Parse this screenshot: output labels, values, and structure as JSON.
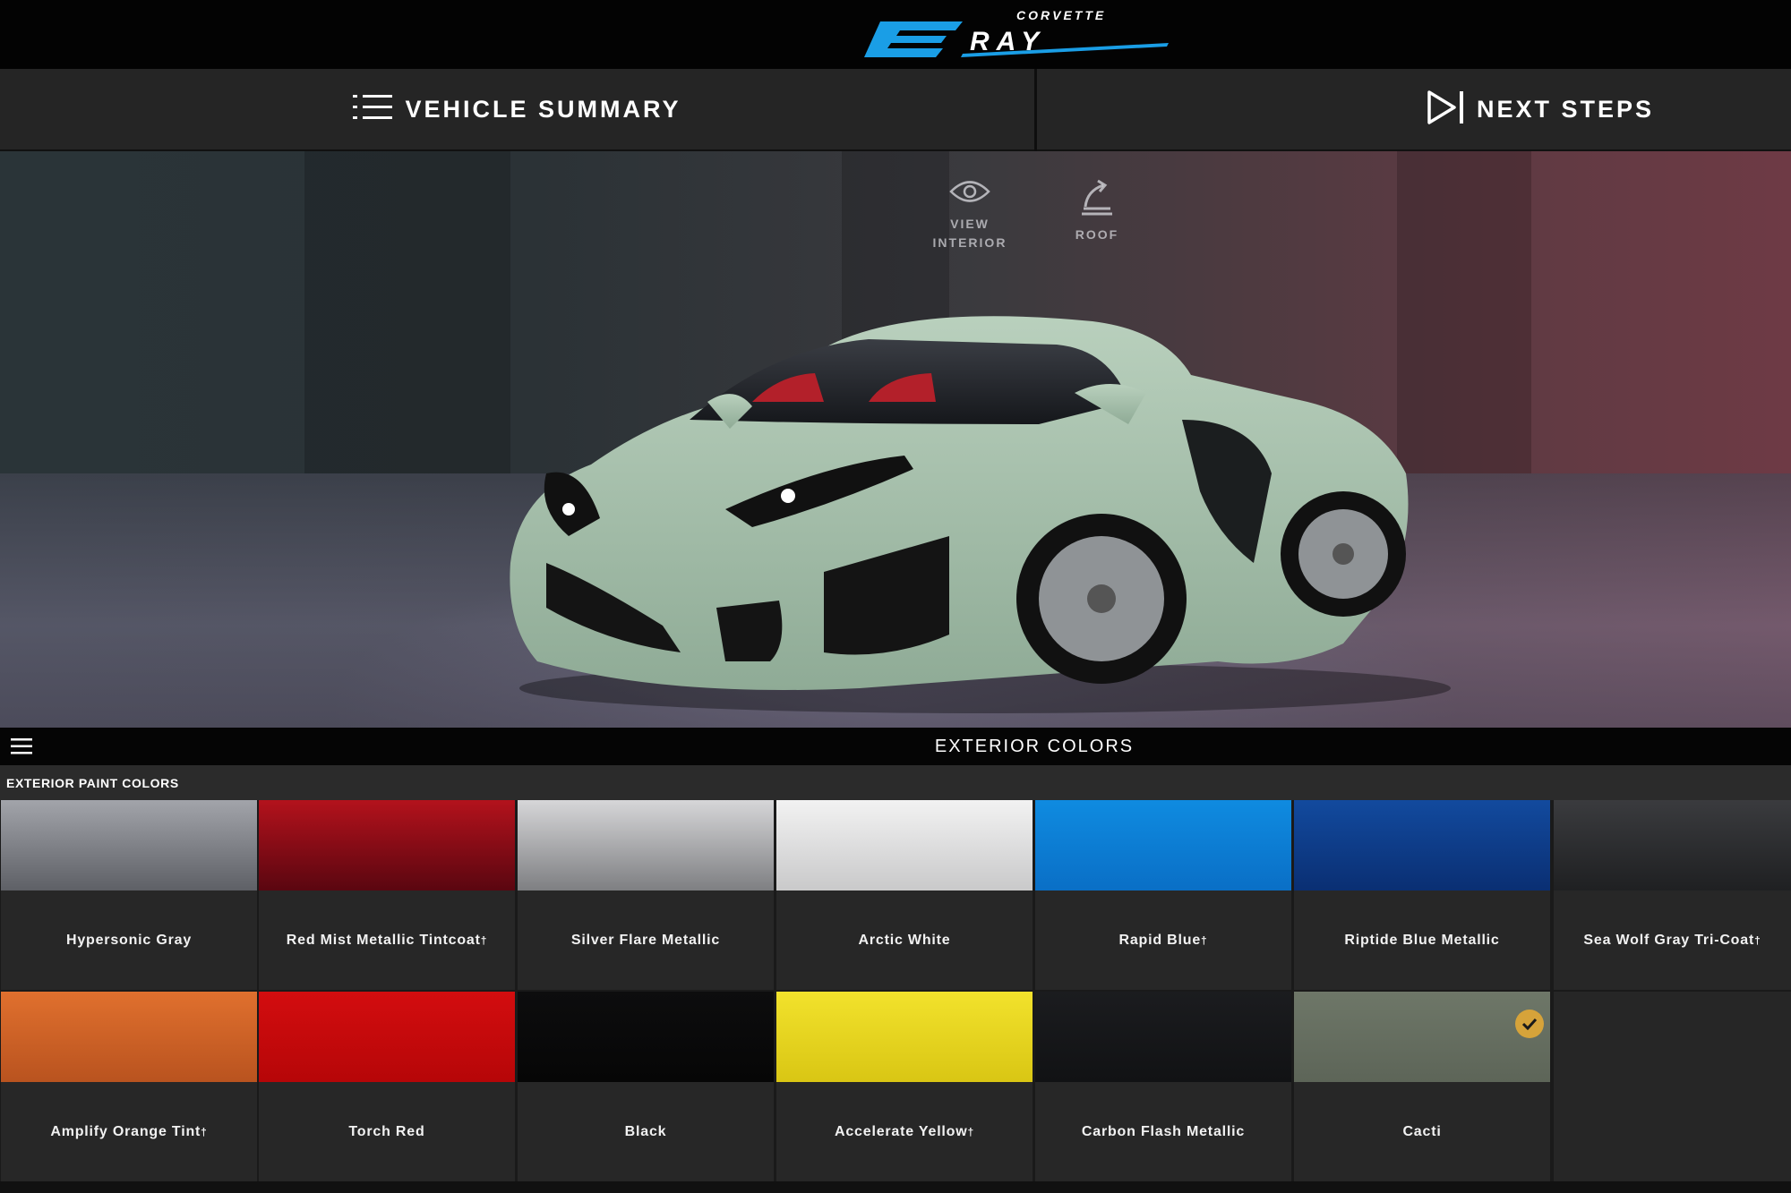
{
  "logo": {
    "top_text": "CORVETTE",
    "main_text": "E-RAY",
    "accent": "#1a9ee6"
  },
  "nav": {
    "summary_label": "VEHICLE SUMMARY",
    "summary_icon": "list-icon",
    "next_label": "NEXT STEPS",
    "next_icon": "play-bar-icon"
  },
  "stage": {
    "view_interior_label": "VIEW INTERIOR",
    "roof_label": "ROOF",
    "view_interior_icon": "eye-icon",
    "roof_icon": "roof-lift-icon"
  },
  "section": {
    "title": "EXTERIOR COLORS",
    "menu_icon": "hamburger-menu-icon"
  },
  "subsection": {
    "label": "EXTERIOR PAINT COLORS"
  },
  "colors": [
    {
      "name": "Hypersonic Gray",
      "dagger": "",
      "top": "#a2a4aa",
      "bottom": "#5e6066"
    },
    {
      "name": "Red Mist Metallic Tintcoat",
      "dagger": "†",
      "top": "#b3121c",
      "bottom": "#5a0610"
    },
    {
      "name": "Silver Flare Metallic",
      "dagger": "",
      "top": "#d6d6d8",
      "bottom": "#7e7f82"
    },
    {
      "name": "Arctic White",
      "dagger": "",
      "top": "#f2f2f2",
      "bottom": "#c9c9ca"
    },
    {
      "name": "Rapid Blue",
      "dagger": "†",
      "top": "#0f8be0",
      "bottom": "#0a6fc6"
    },
    {
      "name": "Riptide Blue Metallic",
      "dagger": "",
      "top": "#124a9e",
      "bottom": "#0a2f73"
    },
    {
      "name": "Sea Wolf Gray Tri-Coat",
      "dagger": "†",
      "top": "#3a3b3e",
      "bottom": "#1f2022"
    },
    {
      "name": "Amplify Orange Tint",
      "dagger": "†",
      "top": "#e0702e",
      "bottom": "#b9531f"
    },
    {
      "name": "Torch Red",
      "dagger": "",
      "top": "#d30d0f",
      "bottom": "#b60608"
    },
    {
      "name": "Black",
      "dagger": "",
      "top": "#0d0d0e",
      "bottom": "#060606"
    },
    {
      "name": "Accelerate Yellow",
      "dagger": "†",
      "top": "#f2e22c",
      "bottom": "#d9c614"
    },
    {
      "name": "Carbon Flash Metallic",
      "dagger": "",
      "top": "#1b1c1f",
      "bottom": "#111214"
    },
    {
      "name": "Cacti",
      "dagger": "",
      "top": "#6e7768",
      "bottom": "#5d6558",
      "selected": true
    }
  ]
}
